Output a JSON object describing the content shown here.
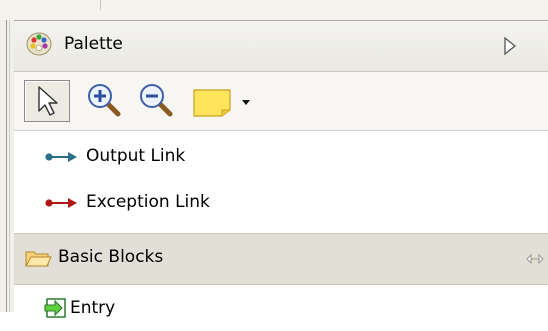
{
  "palette": {
    "title": "Palette",
    "icons": {
      "palette": "palette-icon",
      "collapse": "triangle-right-icon"
    }
  },
  "toolbar": {
    "tools": [
      {
        "name": "select",
        "icon": "arrow-cursor-icon",
        "selected": true
      },
      {
        "name": "zoom-in",
        "icon": "zoom-in-icon"
      },
      {
        "name": "zoom-out",
        "icon": "zoom-out-icon"
      },
      {
        "name": "note",
        "icon": "note-icon"
      },
      {
        "name": "dropdown",
        "icon": "dropdown-arrow-icon"
      }
    ]
  },
  "links": [
    {
      "label": "Output Link",
      "icon": "output-link-icon",
      "color": "#2a6e8a"
    },
    {
      "label": "Exception Link",
      "icon": "exception-link-icon",
      "color": "#b01818"
    }
  ],
  "drawer": {
    "label": "Basic Blocks",
    "icon": "folder-open-icon",
    "pin_icon": "pin-icon",
    "items": [
      {
        "label": "Entry",
        "icon": "entry-block-icon"
      }
    ]
  }
}
